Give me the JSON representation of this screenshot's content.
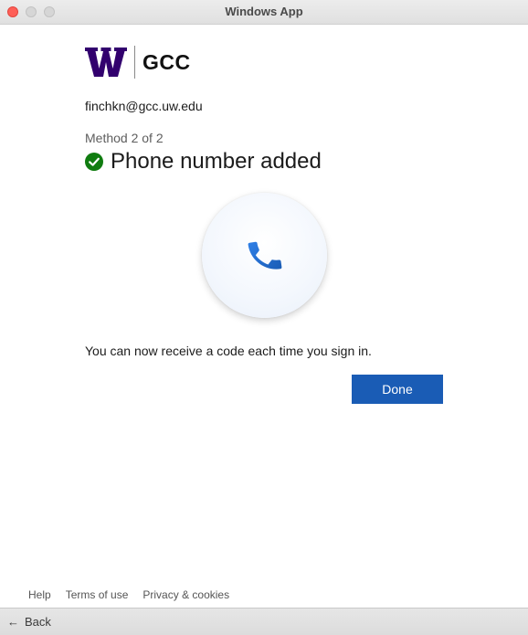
{
  "window": {
    "title": "Windows App"
  },
  "brand": {
    "org_name": "GCC",
    "logo_color": "#32006e"
  },
  "account": {
    "email": "finchkn@gcc.uw.edu"
  },
  "progress": {
    "method_label": "Method 2 of 2"
  },
  "status": {
    "heading": "Phone number added",
    "success_color": "#107c10"
  },
  "message": {
    "text": "You can now receive a code each time you sign in."
  },
  "actions": {
    "done_label": "Done",
    "accent_color": "#1a5cb5"
  },
  "icons": [
    "uw-w-logo",
    "check-circle-icon",
    "phone-icon",
    "back-arrow-icon"
  ],
  "footer": {
    "help": "Help",
    "terms": "Terms of use",
    "privacy": "Privacy & cookies"
  },
  "bottombar": {
    "back_label": "Back",
    "back_glyph": "←"
  }
}
